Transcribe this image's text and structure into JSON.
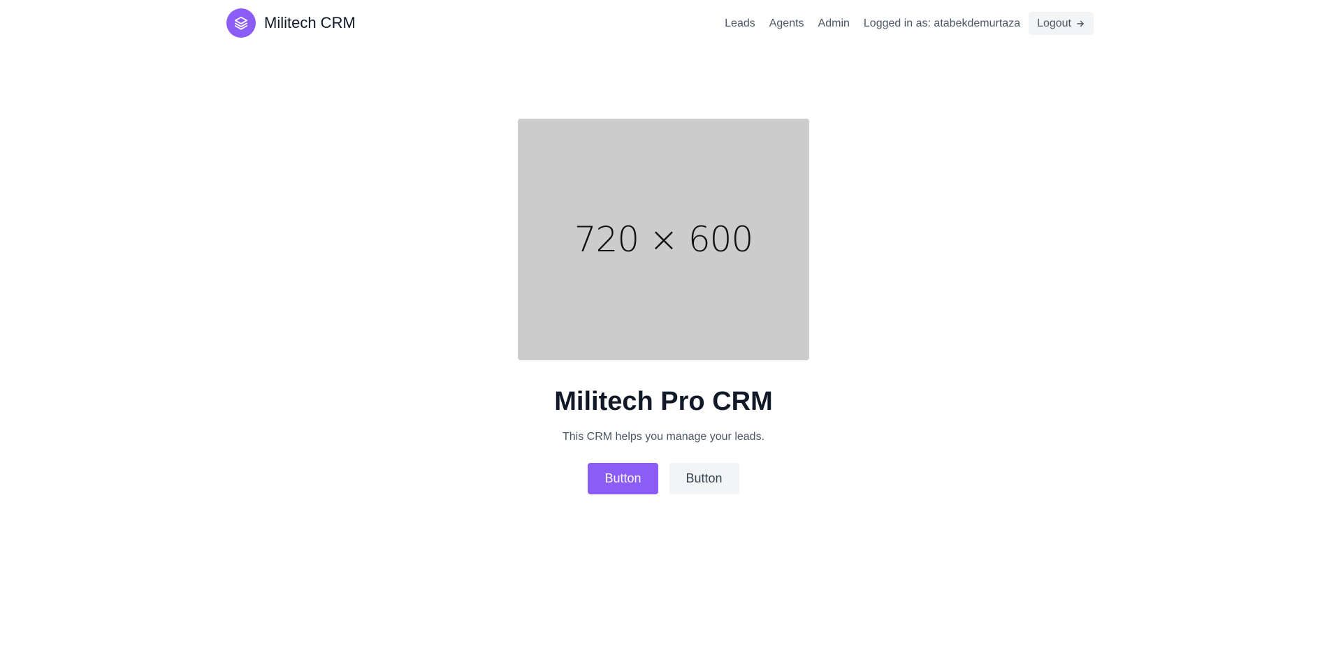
{
  "header": {
    "brand_name": "Militech CRM",
    "brand_icon": "stacked-layers-icon",
    "nav": {
      "leads": "Leads",
      "agents": "Agents",
      "admin": "Admin",
      "logged_in_as": "Logged in as: atabekdemurtaza",
      "logout": "Logout",
      "logout_icon": "arrow-right-icon"
    }
  },
  "hero": {
    "image_placeholder": "720 × 600",
    "title": "Militech Pro CRM",
    "subtitle": "This CRM helps you manage your leads.",
    "primary_button": "Button",
    "secondary_button": "Button"
  },
  "colors": {
    "accent": "#8b5cf6",
    "placeholder_bg": "#cccccc",
    "secondary_button_bg": "#f3f4f6"
  }
}
